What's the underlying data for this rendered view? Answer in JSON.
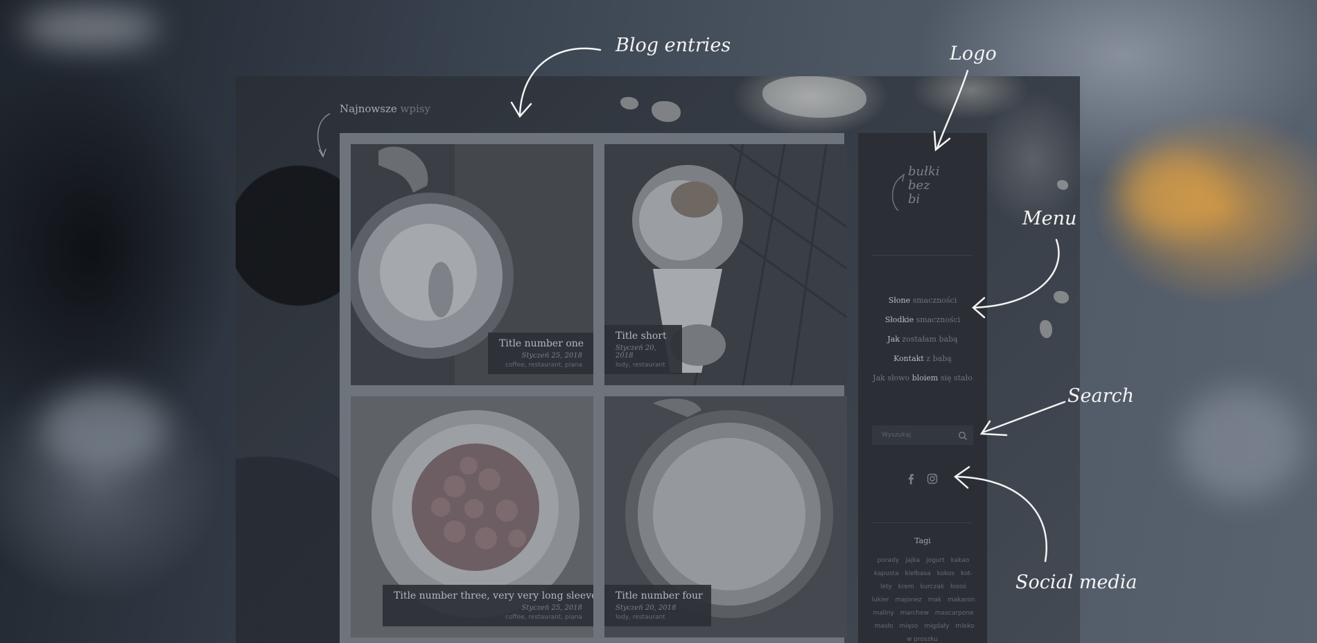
{
  "annotations": {
    "blog_entries": "Blog entries",
    "logo": "Logo",
    "menu": "Menu",
    "search": "Search",
    "social_media": "Social media"
  },
  "latest": {
    "strong": "Najnowsze",
    "muted": "wpisy"
  },
  "posts": [
    {
      "title": "Title number one",
      "date": "Styczeń 25, 2018",
      "tags": "coffee, restaurant, piana"
    },
    {
      "title": "Title short",
      "date": "Styczeń 20, 2018",
      "tags": "lody, restaurant"
    },
    {
      "title": "Title number three, very very long sleeve",
      "date": "Styczeń 25, 2018",
      "tags": "coffee, restaurant, piana"
    },
    {
      "title": "Title number four",
      "date": "Styczeń 20, 2018",
      "tags": "lody, restaurant"
    }
  ],
  "logo": {
    "lines": [
      "bułki",
      "bez",
      "bi"
    ]
  },
  "menu": [
    {
      "strong": "Słone",
      "muted": "smaczności"
    },
    {
      "strong": "Słodkie",
      "muted": "smaczności"
    },
    {
      "strong": "Jak",
      "muted": "zostałam babą"
    },
    {
      "strong": "Kontakt",
      "muted": "z babą"
    },
    {
      "pre": "Jak słowo",
      "strong": "bloiem",
      "muted": "się stało"
    }
  ],
  "search": {
    "placeholder": "Wyszukaj"
  },
  "social": [
    "facebook-icon",
    "instagram-icon"
  ],
  "tags": {
    "title": "Tagi",
    "items": [
      "porady",
      "jajka",
      "jogurt",
      "kakao",
      "kapusta",
      "kiełbasa",
      "kokos",
      "kot-",
      "lety",
      "krem",
      "kurczak",
      "łosoś",
      "lukier",
      "majonez",
      "mak",
      "makaron",
      "maliny",
      "marchew",
      "mascarpone",
      "masło",
      "mięso",
      "migdały",
      "mleko w proszku"
    ]
  },
  "colors": {
    "sidebar": "#2b2f35",
    "grid_frame": "#6d747c",
    "annotation": "#f4f4f4"
  }
}
